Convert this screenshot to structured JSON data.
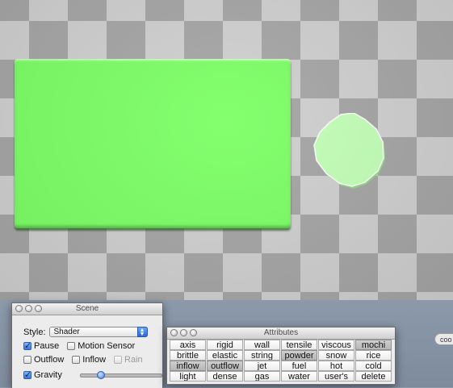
{
  "scene_window": {
    "title": "Scene",
    "style_label": "Style:",
    "style_value": "Shader",
    "pause": {
      "label": "Pause",
      "checked": true
    },
    "motion_sensor": {
      "label": "Motion Sensor",
      "checked": false
    },
    "outflow": {
      "label": "Outflow",
      "checked": false
    },
    "inflow": {
      "label": "Inflow",
      "checked": false
    },
    "rain": {
      "label": "Rain",
      "checked": false,
      "disabled": true
    },
    "gravity": {
      "label": "Gravity",
      "checked": true,
      "level": 0.25
    }
  },
  "attributes_window": {
    "title": "Attributes",
    "buttons": [
      {
        "label": "axis",
        "on": false
      },
      {
        "label": "rigid",
        "on": false
      },
      {
        "label": "wall",
        "on": false
      },
      {
        "label": "tensile",
        "on": false
      },
      {
        "label": "viscous",
        "on": false
      },
      {
        "label": "mochi",
        "on": true
      },
      {
        "label": "brittle",
        "on": false
      },
      {
        "label": "elastic",
        "on": false
      },
      {
        "label": "string",
        "on": false
      },
      {
        "label": "powder",
        "on": true
      },
      {
        "label": "snow",
        "on": false
      },
      {
        "label": "rice",
        "on": false
      },
      {
        "label": "inflow",
        "on": true
      },
      {
        "label": "outflow",
        "on": true
      },
      {
        "label": "jet",
        "on": false
      },
      {
        "label": "fuel",
        "on": false
      },
      {
        "label": "hot",
        "on": false
      },
      {
        "label": "cold",
        "on": false
      },
      {
        "label": "light",
        "on": false
      },
      {
        "label": "dense",
        "on": false
      },
      {
        "label": "gas",
        "on": false
      },
      {
        "label": "water",
        "on": false
      },
      {
        "label": "user's",
        "on": false
      },
      {
        "label": "delete",
        "on": false
      }
    ]
  },
  "edge_button": {
    "label": "coo"
  },
  "scene": {
    "block_color": "#7dff66",
    "blob_color": "#c4ffb8"
  }
}
